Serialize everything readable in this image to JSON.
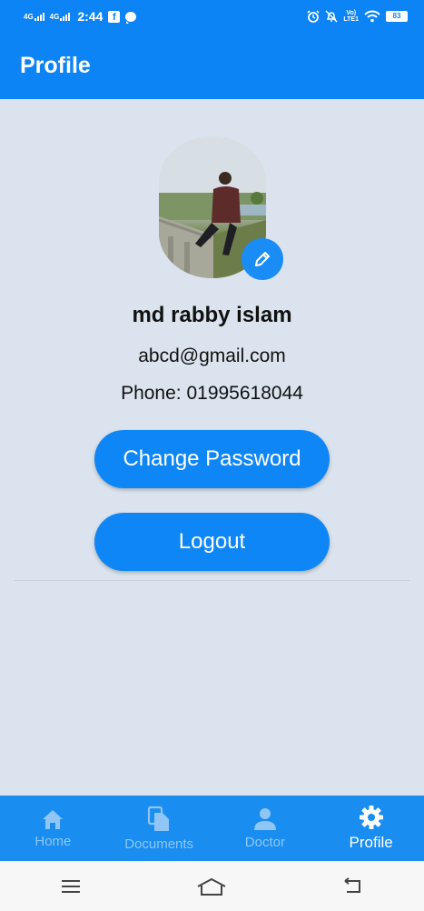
{
  "status_bar": {
    "signal_1": "4G",
    "signal_2": "4G",
    "time": "2:44",
    "fb_letter": "f",
    "volte": "Vo)",
    "lte": "LTE1",
    "battery": "83"
  },
  "app_bar": {
    "title": "Profile"
  },
  "profile": {
    "name": "md rabby islam",
    "email": "abcd@gmail.com",
    "phone": "Phone: 01995618044"
  },
  "actions": {
    "change_password": "Change Password",
    "logout": "Logout"
  },
  "bottom_nav": {
    "items": [
      {
        "label": "Home",
        "icon": "home-icon",
        "active": false
      },
      {
        "label": "Documents",
        "icon": "documents-icon",
        "active": false
      },
      {
        "label": "Doctor",
        "icon": "person-icon",
        "active": false
      },
      {
        "label": "Profile",
        "icon": "gear-icon",
        "active": true
      }
    ]
  },
  "colors": {
    "primary": "#0d84f5",
    "background": "#dbe4ee",
    "nav_inactive": "#8fc6f6"
  }
}
